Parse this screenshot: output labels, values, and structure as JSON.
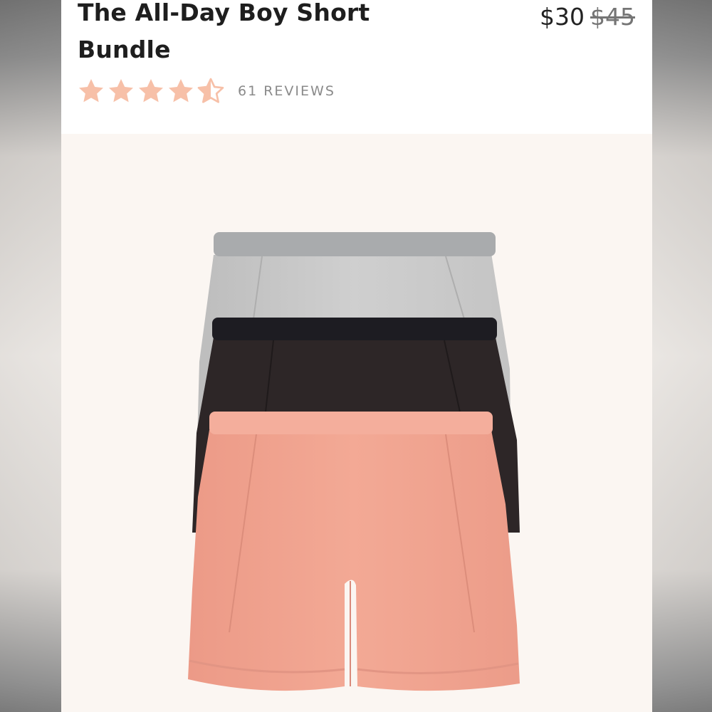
{
  "product": {
    "title": "The All-Day Boy Short Bundle",
    "price": "$30",
    "original_price": "$45",
    "rating": 4.5,
    "rating_max": 5,
    "reviews_label": "61 REVIEWS"
  },
  "colors": {
    "star": "#f7c0a8",
    "background": "#fbf7f3",
    "short_gray": "#c9c9c9",
    "short_black": "#2b2526",
    "short_pink": "#f0a290"
  },
  "image": {
    "subject": "three boy shorts stacked: gray, black, pink"
  }
}
